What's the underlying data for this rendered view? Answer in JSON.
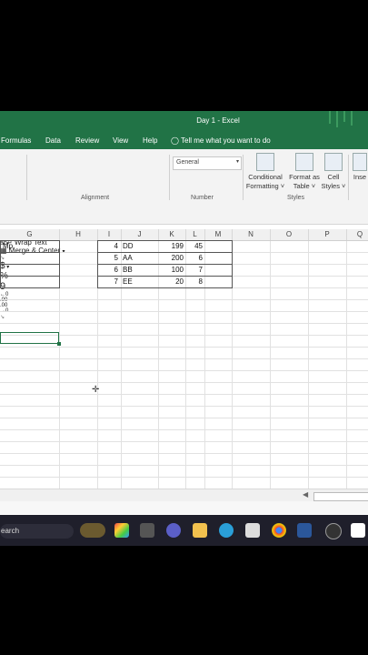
{
  "window": {
    "title": "Day 1  -  Excel"
  },
  "menu": [
    "Formulas",
    "Data",
    "Review",
    "View",
    "Help"
  ],
  "tell_me": "Tell me what you want to do",
  "ribbon": {
    "font_grow": "A",
    "font_shrink": "A",
    "wrap_text": "Wrap Text",
    "merge_center": "Merge & Center",
    "number_format": "General",
    "currency": "$",
    "percent": "%",
    "comma": "9",
    "inc_decimal": "←.0\n.00",
    "conditional_formatting": [
      "Conditional",
      "Formatting ˅"
    ],
    "format_as_table": [
      "Format as",
      "Table ˅"
    ],
    "cell_styles": [
      "Cell",
      "Styles ˅"
    ],
    "insert": "Inse",
    "groups": {
      "alignment": "Alignment",
      "number": "Number",
      "styles": "Styles"
    }
  },
  "columns": [
    "G",
    "H",
    "I",
    "J",
    "K",
    "L",
    "M",
    "N",
    "O",
    "P",
    "Q"
  ],
  "cells": {
    "g1": "Mp",
    "rows": [
      {
        "i": "4",
        "j": "DD",
        "k": "199",
        "l": "45"
      },
      {
        "i": "5",
        "j": "AA",
        "k": "200",
        "l": "6"
      },
      {
        "i": "6",
        "j": "BB",
        "k": "100",
        "l": "7"
      },
      {
        "i": "7",
        "j": "EE",
        "k": "20",
        "l": "8"
      }
    ]
  },
  "taskbar": {
    "search": "earch"
  },
  "colors": {
    "excel_green": "#217346"
  }
}
